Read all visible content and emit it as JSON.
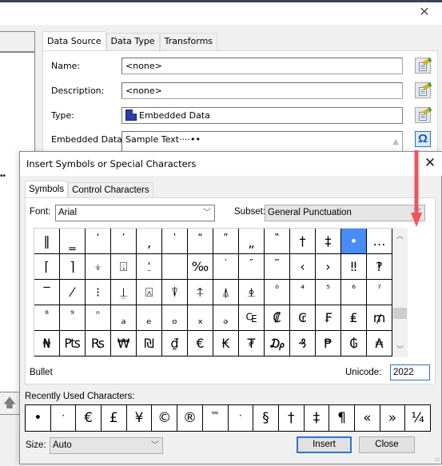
{
  "background_window": {
    "close_glyph": "✕",
    "tabs": [
      "Data Source",
      "Data Type",
      "Transforms"
    ],
    "active_tab": "Data Source",
    "fields": {
      "name": {
        "label": "Name:",
        "value": "<none>"
      },
      "description": {
        "label": "Description:",
        "value": "<none>"
      },
      "type": {
        "label": "Type:",
        "value": "Embedded Data"
      },
      "embedded_data": {
        "label": "Embedded Data:",
        "value": "Sample Text····••"
      }
    },
    "left_pane_ellipsis": "••",
    "up_arrow_glyph": "🡅",
    "omega_glyph": "Ω"
  },
  "dialog": {
    "title": "Insert Symbols or Special Characters",
    "close_glyph": "✕",
    "tabs": [
      "Symbols",
      "Control Characters"
    ],
    "active_tab": "Symbols",
    "font_label": "Font:",
    "font_value": "Arial",
    "subset_label": "Subset:",
    "subset_value": "General Punctuation",
    "grid": [
      [
        "‖",
        "‗",
        "‘",
        "’",
        "‚",
        "‛",
        "“",
        "”",
        "„",
        "‟",
        "†",
        "‡",
        "•",
        "…"
      ],
      [
        "⌈",
        "⌉",
        "⍖",
        "⍗",
        "⍘",
        "",
        "‰",
        "′",
        "″",
        "‴",
        "‹",
        "›",
        "‼",
        "‽"
      ],
      [
        "‾",
        "⁄",
        "⁝",
        "⍊",
        "⍓",
        "⍒",
        "⍏",
        "⍋",
        "⍎",
        "⁰",
        "⁴",
        "⁵",
        "⁶",
        "⁷"
      ],
      [
        "⁸",
        "⁹",
        "ⁿ",
        "ₐ",
        "ₑ",
        "ₒ",
        "ₓ",
        "ₔ",
        "₠",
        "₡",
        "₢",
        "₣",
        "₤",
        "₥"
      ],
      [
        "₦",
        "₧",
        "₨",
        "₩",
        "₪",
        "₫",
        "€",
        "₭",
        "₮",
        "₯",
        "₰",
        "₱",
        "₲",
        "₳"
      ]
    ],
    "selected_char": "•",
    "selected_name": "Bullet",
    "unicode_label": "Unicode:",
    "unicode_value": "2022",
    "recent_label": "Recently Used Characters:",
    "recent": [
      "•",
      "·",
      "€",
      "£",
      "¥",
      "©",
      "®",
      "™",
      "·",
      "§",
      "†",
      "‡",
      "¶",
      "«",
      "»",
      "¼"
    ],
    "size_label": "Size:",
    "size_value": "Auto",
    "insert_label": "Insert",
    "close_label": "Close"
  },
  "annotation": {
    "arrow_color": "#f0545c"
  },
  "colors": {
    "selection": "#4a8cf7",
    "focus_border": "#2f74d0"
  }
}
